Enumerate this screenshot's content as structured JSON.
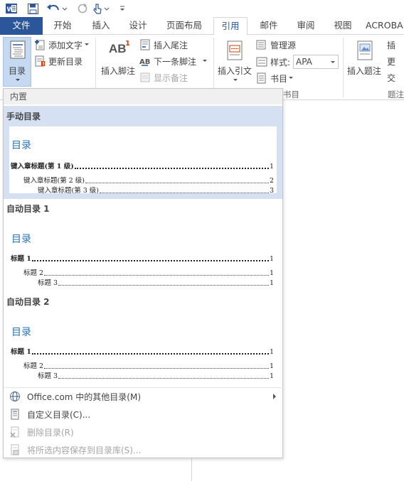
{
  "qat": {
    "app_icon": "word-app-icon",
    "save_icon": "save-icon",
    "undo_icon": "undo-icon",
    "redo_icon": "redo-icon",
    "touch_icon": "touch-mode-icon",
    "customize_icon": "customize-qat-icon"
  },
  "tabs": {
    "file": "文件",
    "home": "开始",
    "insert": "插入",
    "design": "设计",
    "layout": "页面布局",
    "references": "引用",
    "mailings": "邮件",
    "review": "审阅",
    "view": "视图",
    "acrobat": "ACROBA"
  },
  "ribbon": {
    "toc_button": "目录",
    "add_text": "添加文字",
    "update_toc": "更新目录",
    "insert_footnote": "插入脚注",
    "footnote_ab_icon": "AB",
    "footnote_sup": "1",
    "insert_endnote": "插入尾注",
    "next_footnote": "下一条脚注",
    "show_notes": "显示备注",
    "insert_citation": "插入引文",
    "manage_sources": "管理源",
    "style_label": "样式:",
    "style_value": "APA",
    "bibliography": "书目",
    "citations_group": "书目",
    "insert_caption": "插入题注",
    "captions_group": "题注",
    "cut_text_1": "插",
    "cut_text_2": "更",
    "cut_text_3": "交"
  },
  "dropdown": {
    "builtin_header": "内置",
    "manual_toc": {
      "title": "手动目录",
      "heading": "目录",
      "lines": [
        {
          "label": "键入章标题(第 1 级)",
          "page": "1"
        },
        {
          "label": "键入章标题(第 2 级)",
          "page": "2"
        },
        {
          "label": "键入章标题(第 3 级)",
          "page": "3"
        }
      ]
    },
    "auto_toc_1": {
      "title": "自动目录 1",
      "heading": "目录",
      "lines": [
        {
          "label": "标题 1",
          "page": "1"
        },
        {
          "label": "标题 2",
          "page": "1"
        },
        {
          "label": "标题 3",
          "page": "1"
        }
      ]
    },
    "auto_toc_2": {
      "title": "自动目录 2",
      "heading": "目录",
      "lines": [
        {
          "label": "标题 1",
          "page": "1"
        },
        {
          "label": "标题 2",
          "page": "1"
        },
        {
          "label": "标题 3",
          "page": "1"
        }
      ]
    },
    "menu": {
      "more_toc": "Office.com 中的其他目录(M)",
      "custom_toc": "自定义目录(C)...",
      "remove_toc": "删除目录(R)",
      "save_selection": "将所选内容保存到目录库(S)..."
    }
  },
  "colors": {
    "file_tab": "#2b579a",
    "accent": "#2b579a",
    "toc_heading": "#2e74b5",
    "selected_item": "#d5e1f2"
  }
}
